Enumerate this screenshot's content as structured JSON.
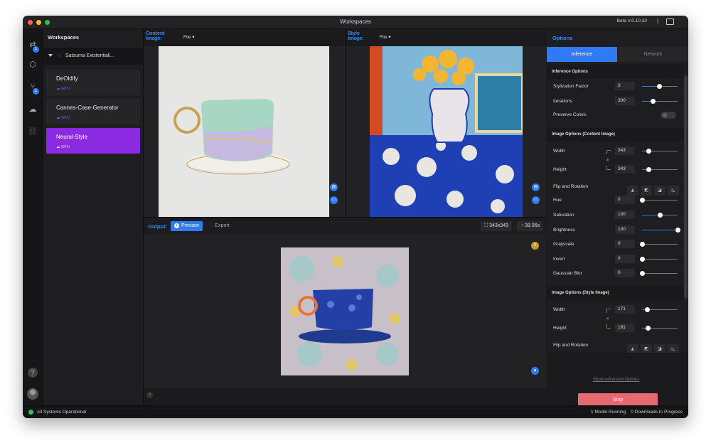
{
  "window": {
    "title": "Workspaces",
    "version": "Beta V.0.10.33",
    "separator": "|"
  },
  "rail": {
    "badges": [
      "1",
      "1"
    ],
    "help": "?"
  },
  "sidebar": {
    "title": "Workspaces",
    "workspace": "Satsuma Existentiali...",
    "models": [
      {
        "name": "DeOldify",
        "tag": "GPU"
      },
      {
        "name": "Cannes-Case-Generator",
        "tag": "GPU"
      },
      {
        "name": "Neural-Style",
        "tag": "GPU"
      }
    ]
  },
  "content": {
    "label_line1": "Content",
    "label_line2": "Image:",
    "file": "File"
  },
  "style": {
    "label_line1": "Style",
    "label_line2": "Image:",
    "file": "File"
  },
  "output": {
    "label": "Output:",
    "preview": "Preview",
    "export": "Export",
    "size": "343x343",
    "time": "38.06s"
  },
  "options": {
    "title": "Options",
    "tabs": {
      "inference": "Inference",
      "network": "Network"
    },
    "inference_section": "Inference Options",
    "stylization_label": "Stylization Factor",
    "stylization_value": "3",
    "stylization_level": 0.48,
    "iterations_label": "Iterations",
    "iterations_value": "300",
    "iterations_level": 0.3,
    "preserve_label": "Preserve Colors",
    "content_section": "Image Options (Content Image)",
    "c_width_label": "Width",
    "c_width_value": "343",
    "c_width_level": 0.18,
    "c_height_label": "Height",
    "c_height_value": "343",
    "c_height_level": 0.18,
    "c_flip_label": "Flip and Rotation",
    "hue_label": "Hue",
    "hue_value": "0",
    "hue_level": 0.0,
    "sat_label": "Saturation",
    "sat_value": "100",
    "sat_level": 0.5,
    "bri_label": "Brightness",
    "bri_value": "100",
    "bri_level": 1.0,
    "gray_label": "Grayscale",
    "gray_value": "0",
    "gray_level": 0.0,
    "inv_label": "Invert",
    "inv_value": "0",
    "inv_level": 0.0,
    "blur_label": "Gaussian Blur",
    "blur_value": "0",
    "blur_level": 0.0,
    "style_section": "Image Options (Style Image)",
    "s_width_label": "Width",
    "s_width_value": "171",
    "s_width_level": 0.14,
    "s_height_label": "Height",
    "s_height_value": "191",
    "s_height_level": 0.16,
    "s_flip_label": "Flip and Rotation",
    "advanced": "Show Advanced Options",
    "stop": "Stop"
  },
  "status": {
    "left": "All Systems Operational",
    "models": "1 Model Running",
    "downloads": "0 Downloads In Progress"
  },
  "colors": {
    "accent": "#2f7bf5",
    "active_model": "#8a2be2",
    "stop": "#e86872",
    "ok": "#3dbf5c"
  }
}
